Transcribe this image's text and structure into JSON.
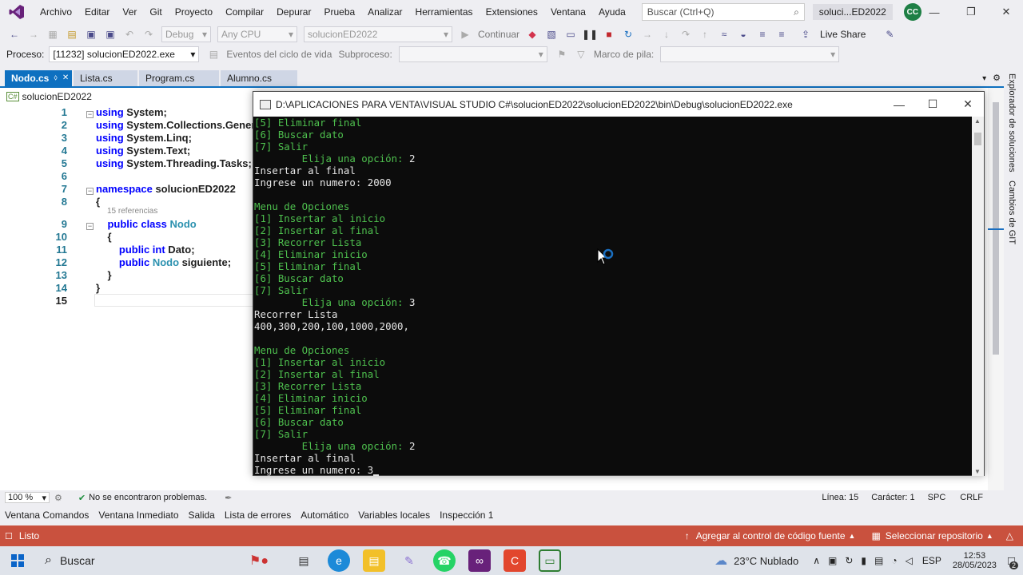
{
  "menu": {
    "items": [
      "Archivo",
      "Editar",
      "Ver",
      "Git",
      "Proyecto",
      "Compilar",
      "Depurar",
      "Prueba",
      "Analizar",
      "Herramientas",
      "Extensiones",
      "Ventana",
      "Ayuda"
    ],
    "search_placeholder": "Buscar (Ctrl+Q)",
    "solution_short": "soluci...ED2022",
    "avatar": "CC"
  },
  "toolbar": {
    "config": "Debug",
    "platform": "Any CPU",
    "startup": "solucionED2022",
    "continue": "Continuar",
    "live_share": "Live Share",
    "process_label": "Proceso:",
    "process_value": "[11232] solucionED2022.exe",
    "lifecycle": "Eventos del ciclo de vida",
    "thread_label": "Subproceso:",
    "stack_label": "Marco de pila:"
  },
  "tabs": [
    "Nodo.cs",
    "Lista.cs",
    "Program.cs",
    "Alumno.cs"
  ],
  "editor": {
    "nav": "solucionED2022",
    "lines": [
      {
        "n": "1",
        "html": "<span class='kw'>using</span> System;"
      },
      {
        "n": "2",
        "html": "<span class='kw'>using</span> System.Collections.Generic;"
      },
      {
        "n": "3",
        "html": "<span class='kw'>using</span> System.Linq;"
      },
      {
        "n": "4",
        "html": "<span class='kw'>using</span> System.Text;"
      },
      {
        "n": "5",
        "html": "<span class='kw'>using</span> System.Threading.Tasks;"
      },
      {
        "n": "6",
        "html": ""
      },
      {
        "n": "7",
        "html": "<span class='kw'>namespace</span> solucionED2022"
      },
      {
        "n": "8",
        "html": "{"
      },
      {
        "n": "9",
        "html": "&nbsp;&nbsp;&nbsp;&nbsp;<span class='kw'>public class</span> <span class='ty'>Nodo</span>"
      },
      {
        "n": "10",
        "html": "&nbsp;&nbsp;&nbsp;&nbsp;{"
      },
      {
        "n": "11",
        "html": "&nbsp;&nbsp;&nbsp;&nbsp;&nbsp;&nbsp;&nbsp;&nbsp;<span class='kw'>public int</span> Dato;"
      },
      {
        "n": "12",
        "html": "&nbsp;&nbsp;&nbsp;&nbsp;&nbsp;&nbsp;&nbsp;&nbsp;<span class='kw'>public</span> <span class='ty'>Nodo</span> siguiente;"
      },
      {
        "n": "13",
        "html": "&nbsp;&nbsp;&nbsp;&nbsp;}"
      },
      {
        "n": "14",
        "html": "}"
      },
      {
        "n": "15",
        "html": ""
      }
    ],
    "references": "15 referencias",
    "zoom": "100 %",
    "problems": "No se encontraron problemas.",
    "line_info": "Línea: 15",
    "char_info": "Carácter: 1",
    "spc": "SPC",
    "crlf": "CRLF"
  },
  "console": {
    "title": "D:\\APLICACIONES PARA VENTA\\VISUAL STUDIO C#\\solucionED2022\\solucionED2022\\bin\\Debug\\solucionED2022.exe",
    "lines": [
      {
        "t": "[5] Eliminar final",
        "c": "green"
      },
      {
        "t": "[6] Buscar dato",
        "c": "green"
      },
      {
        "t": "[7] Salir",
        "c": "green"
      },
      {
        "t": "        Elija una opción: ",
        "c": "green",
        "v": "2"
      },
      {
        "t": "Insertar al final",
        "c": "white"
      },
      {
        "t": "Ingrese un numero: 2000",
        "c": "white"
      },
      {
        "t": "",
        "c": "white"
      },
      {
        "t": "Menu de Opciones",
        "c": "green"
      },
      {
        "t": "[1] Insertar al inicio",
        "c": "green"
      },
      {
        "t": "[2] Insertar al final",
        "c": "green"
      },
      {
        "t": "[3] Recorrer Lista",
        "c": "green"
      },
      {
        "t": "[4] Eliminar inicio",
        "c": "green"
      },
      {
        "t": "[5] Eliminar final",
        "c": "green"
      },
      {
        "t": "[6] Buscar dato",
        "c": "green"
      },
      {
        "t": "[7] Salir",
        "c": "green"
      },
      {
        "t": "        Elija una opción: ",
        "c": "green",
        "v": "3"
      },
      {
        "t": "Recorrer Lista",
        "c": "white"
      },
      {
        "t": "400,300,200,100,1000,2000,",
        "c": "white"
      },
      {
        "t": "",
        "c": "white"
      },
      {
        "t": "Menu de Opciones",
        "c": "green"
      },
      {
        "t": "[1] Insertar al inicio",
        "c": "green"
      },
      {
        "t": "[2] Insertar al final",
        "c": "green"
      },
      {
        "t": "[3] Recorrer Lista",
        "c": "green"
      },
      {
        "t": "[4] Eliminar inicio",
        "c": "green"
      },
      {
        "t": "[5] Eliminar final",
        "c": "green"
      },
      {
        "t": "[6] Buscar dato",
        "c": "green"
      },
      {
        "t": "[7] Salir",
        "c": "green"
      },
      {
        "t": "        Elija una opción: ",
        "c": "green",
        "v": "2"
      },
      {
        "t": "Insertar al final",
        "c": "white"
      },
      {
        "t": "Ingrese un numero: 3",
        "c": "white",
        "cursor": true
      }
    ]
  },
  "right_panel": {
    "solution_explorer": "Explorador de soluciones",
    "git_changes": "Cambios de GIT"
  },
  "tool_windows": [
    "Ventana Comandos",
    "Ventana Inmediato",
    "Salida",
    "Lista de errores",
    "Automático",
    "Variables locales",
    "Inspección 1"
  ],
  "status": {
    "ready": "Listo",
    "source_control": "Agregar al control de código fuente",
    "repo": "Seleccionar repositorio"
  },
  "taskbar": {
    "search": "Buscar",
    "weather": "23°C  Nublado",
    "lang": "ESP",
    "time": "12:53",
    "date": "28/05/2023",
    "notifications": "2"
  }
}
